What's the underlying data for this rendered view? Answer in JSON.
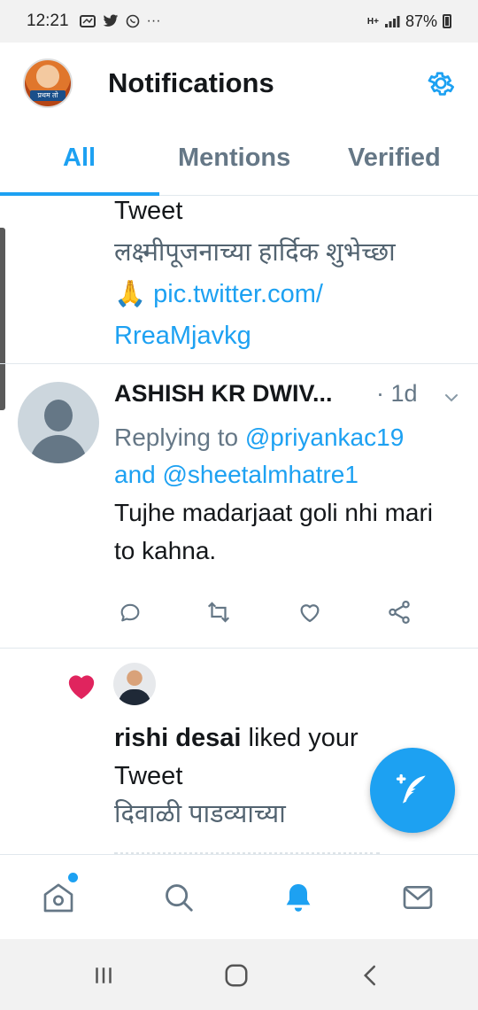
{
  "status_bar": {
    "time": "12:21",
    "icons": [
      "notification-icon",
      "twitter-icon",
      "whatsapp-icon",
      "more-dots-icon"
    ],
    "more": "···",
    "network": "H+",
    "battery": "87%"
  },
  "header": {
    "title": "Notifications",
    "avatar_label": "प्रथम तो"
  },
  "tabs": [
    {
      "label": "All",
      "active": true
    },
    {
      "label": "Mentions",
      "active": false
    },
    {
      "label": "Verified",
      "active": false
    }
  ],
  "feed": {
    "item1": {
      "line1": "Tweet",
      "line2": "लक्ष्मीपूजनाच्या हार्दिक शुभेच्छा",
      "emoji": "🙏",
      "link1": "pic.twitter.com/",
      "link2": "RreaMjavkg"
    },
    "item2": {
      "author": "ASHISH KR DWIV...",
      "time": "· 1d",
      "replying_prefix": "Replying to",
      "mention1": "@priyankac19",
      "and_word": "and",
      "mention2": "@sheetalmhatre1",
      "text": "Tujhe madarjaat goli nhi mari to kahna."
    },
    "item3": {
      "liker": "rishi desai",
      "action": "liked your",
      "tweet_word": "Tweet",
      "snippet": "दिवाळी पाडव्याच्या"
    }
  },
  "colors": {
    "accent": "#1da1f2",
    "like": "#e0245e",
    "secondary_text": "#657786"
  }
}
